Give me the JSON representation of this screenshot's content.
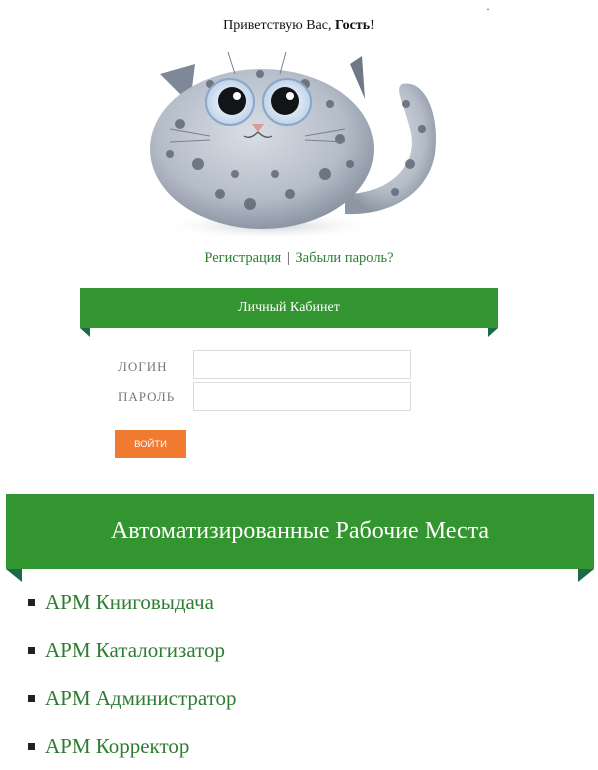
{
  "greeting": {
    "prefix": "Приветствую Вас, ",
    "user": "Гость",
    "suffix": "!"
  },
  "top_dot": "·",
  "links": {
    "register": "Регистрация",
    "separator": "|",
    "forgot": "Забыли пароль?"
  },
  "cabinet": {
    "title": "Личный Кабинет"
  },
  "login_form": {
    "login_label": "ЛОГИН",
    "login_value": "",
    "login_placeholder": "",
    "password_label": "ПАРОЛЬ",
    "password_value": "",
    "password_placeholder": "",
    "submit_label": "ВОЙТИ"
  },
  "workplaces": {
    "title": "Автоматизированные Рабочие Места",
    "items": [
      {
        "label": "АРМ Книговыдача"
      },
      {
        "label": "АРМ Каталогизатор"
      },
      {
        "label": "АРМ Администратор"
      },
      {
        "label": "АРМ Корректор"
      }
    ]
  },
  "colors": {
    "ribbon_green": "#33952f",
    "ribbon_fold": "#1d6b46",
    "link_green": "#2e7d32",
    "button_orange": "#f07a2f"
  },
  "icons": {
    "mascot": "snow-leopard-mascot-icon",
    "bullet": "square-bullet-icon"
  }
}
